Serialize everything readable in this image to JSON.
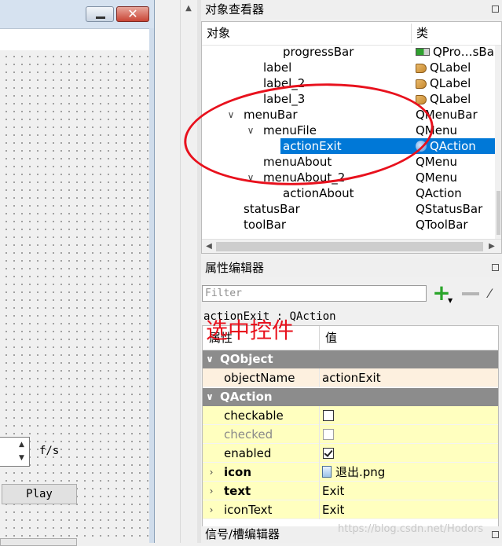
{
  "form": {
    "close_glyph": "✕",
    "spin_up": "▲",
    "spin_down": "▼",
    "unit_label": "f/s",
    "play_label": "Play"
  },
  "object_inspector": {
    "title": "对象查看器",
    "col_object": "对象",
    "col_class": "类",
    "rows": [
      {
        "name": "progressBar",
        "class": "QPro…sBar",
        "icon": "progressbar-icon"
      },
      {
        "name": "label",
        "class": "QLabel",
        "icon": "label-icon"
      },
      {
        "name": "label_2",
        "class": "QLabel",
        "icon": "label-icon"
      },
      {
        "name": "label_3",
        "class": "QLabel",
        "icon": "label-icon"
      },
      {
        "name": "menuBar",
        "class": "QMenuBar",
        "icon": "",
        "expanded": true
      },
      {
        "name": "menuFile",
        "class": "QMenu",
        "icon": "",
        "expanded": true
      },
      {
        "name": "actionExit",
        "class": "QAction",
        "icon": "action-icon",
        "selected": true
      },
      {
        "name": "menuAbout",
        "class": "QMenu",
        "icon": ""
      },
      {
        "name": "menuAbout_2",
        "class": "QMenu",
        "icon": "",
        "expanded": true
      },
      {
        "name": "actionAbout",
        "class": "QAction",
        "icon": ""
      },
      {
        "name": "statusBar",
        "class": "QStatusBar",
        "icon": ""
      },
      {
        "name": "toolBar",
        "class": "QToolBar",
        "icon": ""
      }
    ]
  },
  "annotation": {
    "text": "选中控件",
    "color": "#e8111d"
  },
  "property_editor": {
    "title": "属性编辑器",
    "filter_placeholder": "Filter",
    "object_label": "actionExit : QAction",
    "col_property": "属性",
    "col_value": "值",
    "groups": [
      {
        "name": "QObject"
      },
      {
        "name": "QAction"
      }
    ],
    "rows": [
      {
        "name": "objectName",
        "value": "actionExit"
      },
      {
        "name": "checkable",
        "checked": false
      },
      {
        "name": "checked",
        "checked": false
      },
      {
        "name": "enabled",
        "checked": true
      },
      {
        "name": "icon",
        "value": "退出.png"
      },
      {
        "name": "text",
        "value": "Exit"
      },
      {
        "name": "iconText",
        "value": "Exit"
      }
    ]
  },
  "signal_editor": {
    "title": "信号/槽编辑器"
  },
  "watermark": "https://blog.csdn.net/Hodors"
}
